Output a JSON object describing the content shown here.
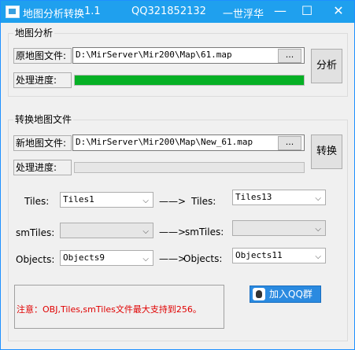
{
  "window": {
    "title": "地图分析转换",
    "version": "1.1",
    "qq": "QQ321852132",
    "author": "一世浮华",
    "min_glyph": "—",
    "max_glyph": "☐",
    "close_glyph": "✕"
  },
  "analysis": {
    "group_title": "地图分析",
    "source_label": "原地图文件:",
    "source_path": "D:\\MirServer\\Mir200\\Map\\61.map",
    "browse_label": "...",
    "progress_label": "处理进度:",
    "progress": 1.0,
    "action_label": "分析"
  },
  "convert": {
    "group_title": "转换地图文件",
    "target_label": "新地图文件:",
    "target_path": "D:\\MirServer\\Mir200\\Map\\New_61.map",
    "browse_label": "...",
    "progress_label": "处理进度:",
    "progress": 0.0,
    "action_label": "转换"
  },
  "mappings": [
    {
      "left_label": "Tiles:",
      "left_value": "Tiles1",
      "arrow": "——>",
      "right_label": "Tiles:",
      "right_value": "Tiles13"
    },
    {
      "left_label": "smTiles:",
      "left_value": "",
      "arrow": "——>",
      "right_label": "smTiles:",
      "right_value": ""
    },
    {
      "left_label": "Objects:",
      "left_value": "Objects9",
      "arrow": "——>",
      "right_label": "Objects:",
      "right_value": "Objects11"
    }
  ],
  "note": {
    "text": "注意：OBJ,Tiles,smTiles文件最大支持到256。",
    "color": "#e00000"
  },
  "qq_group_button": {
    "label": "加入QQ群",
    "icon": "qq-penguin-icon"
  },
  "colors": {
    "titlebar": "#1fa0ee",
    "progress_fill": "#06b025"
  }
}
